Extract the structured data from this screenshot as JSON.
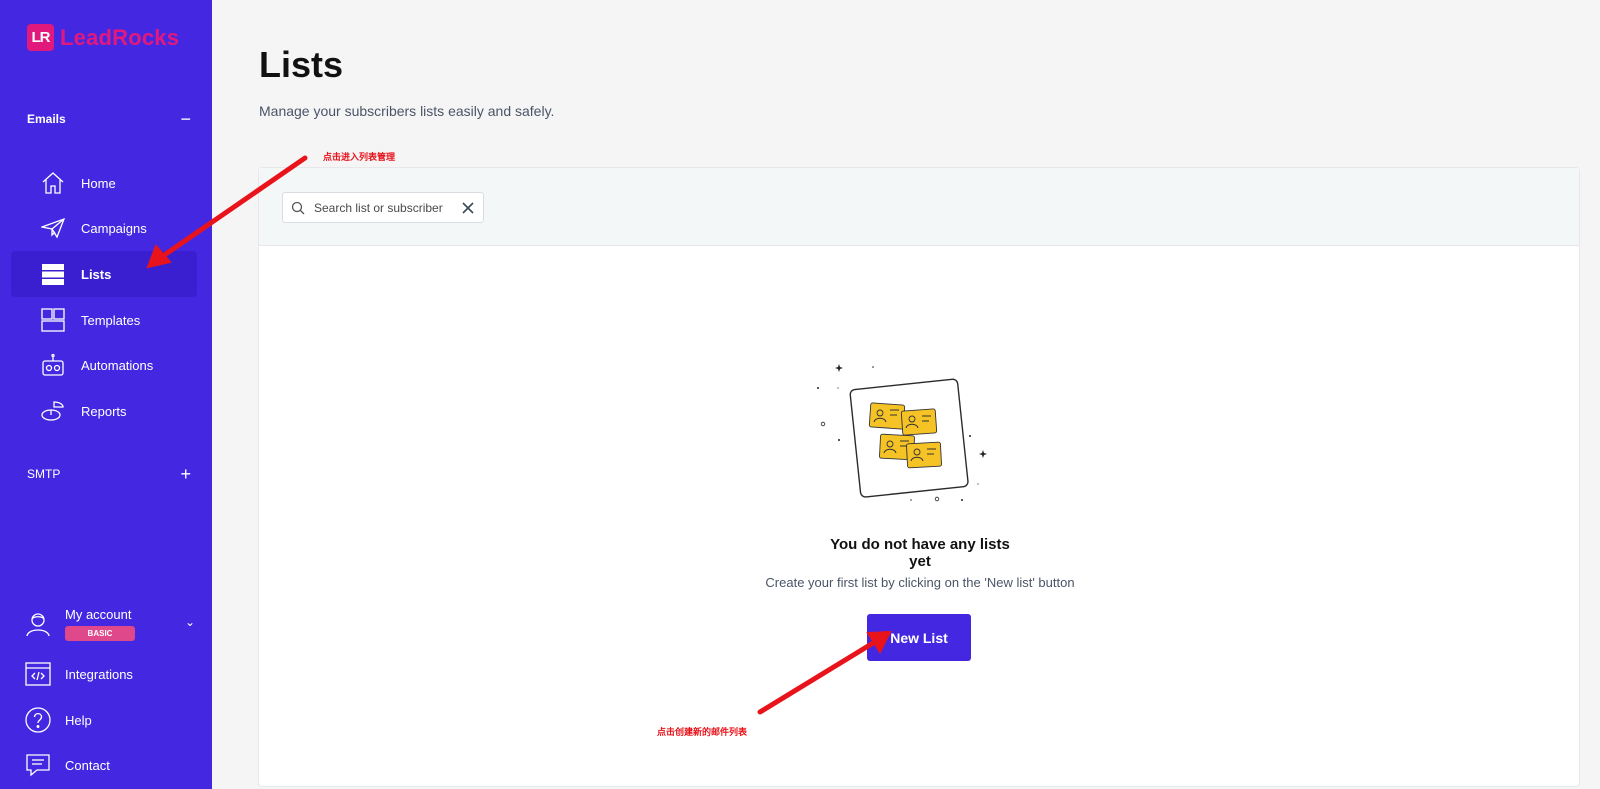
{
  "brand": {
    "logo_mark": "LR",
    "name": "LeadRocks",
    "color": "#e2197c"
  },
  "sidebar": {
    "bg_color": "#4428e1",
    "sections": {
      "emails": {
        "label": "Emails",
        "toggle": "−"
      },
      "smtp": {
        "label": "SMTP",
        "toggle": "+"
      }
    },
    "items": [
      {
        "label": "Home",
        "icon": "home-icon",
        "active": false
      },
      {
        "label": "Campaigns",
        "icon": "paper-plane-icon",
        "active": false
      },
      {
        "label": "Lists",
        "icon": "list-icon",
        "active": true
      },
      {
        "label": "Templates",
        "icon": "templates-icon",
        "active": false
      },
      {
        "label": "Automations",
        "icon": "robot-icon",
        "active": false
      },
      {
        "label": "Reports",
        "icon": "pie-chart-icon",
        "active": false
      }
    ],
    "bottom": {
      "account": {
        "label": "My account",
        "badge": "BASIC",
        "icon": "user-icon",
        "chevron": "⌄"
      },
      "integrations": {
        "label": "Integrations",
        "icon": "code-window-icon"
      },
      "help": {
        "label": "Help",
        "icon": "question-icon"
      },
      "contact": {
        "label": "Contact",
        "icon": "chat-icon"
      }
    }
  },
  "main": {
    "title": "Lists",
    "subtitle": "Manage your subscribers lists easily and safely.",
    "search": {
      "placeholder": "Search list or subscriber",
      "value": ""
    },
    "empty_state": {
      "title": "You do not have any lists yet",
      "subtitle": "Create your first list by clicking on the 'New list' button",
      "button_label": "New List"
    }
  },
  "annotations": {
    "to_lists": "点击进入列表管理",
    "to_new_list": "点击创建新的邮件列表",
    "color": "#e8131b"
  }
}
